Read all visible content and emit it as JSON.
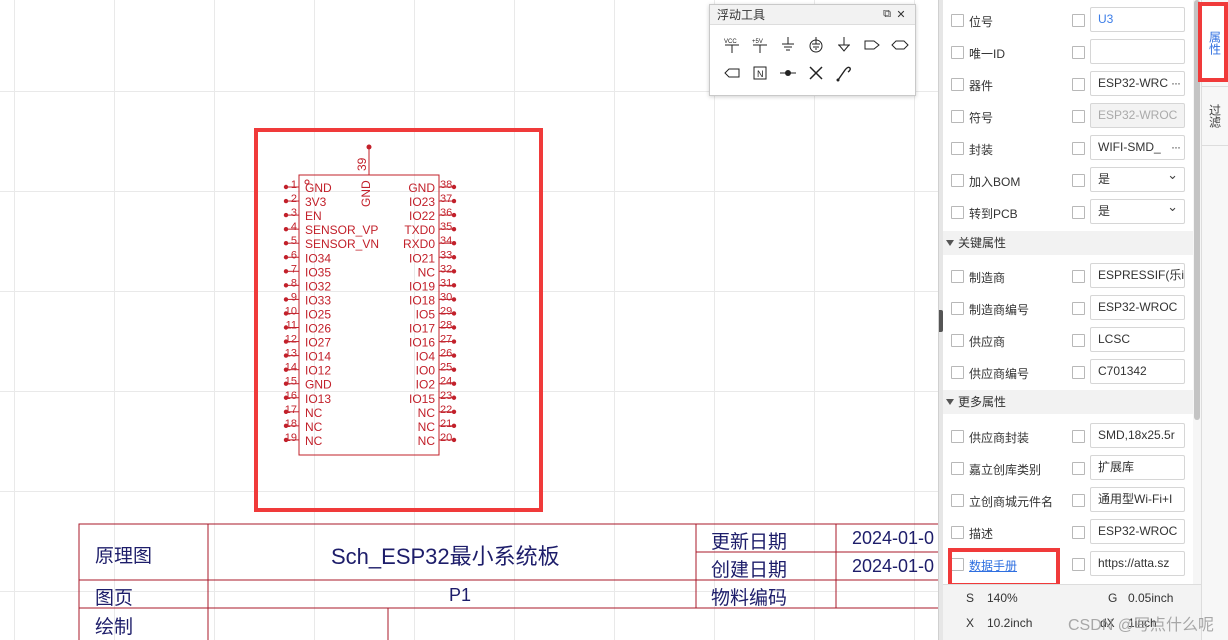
{
  "canvas": {
    "part": {
      "top_pin": {
        "number": "39",
        "name": "GND"
      },
      "left_pins": [
        {
          "num": "1",
          "name": "GND"
        },
        {
          "num": "2",
          "name": "3V3"
        },
        {
          "num": "3",
          "name": "EN"
        },
        {
          "num": "4",
          "name": "SENSOR_VP"
        },
        {
          "num": "5",
          "name": "SENSOR_VN"
        },
        {
          "num": "6",
          "name": "IO34"
        },
        {
          "num": "7",
          "name": "IO35"
        },
        {
          "num": "8",
          "name": "IO32"
        },
        {
          "num": "9",
          "name": "IO33"
        },
        {
          "num": "10",
          "name": "IO25"
        },
        {
          "num": "11",
          "name": "IO26"
        },
        {
          "num": "12",
          "name": "IO27"
        },
        {
          "num": "13",
          "name": "IO14"
        },
        {
          "num": "14",
          "name": "IO12"
        },
        {
          "num": "15",
          "name": "GND"
        },
        {
          "num": "16",
          "name": "IO13"
        },
        {
          "num": "17",
          "name": "NC"
        },
        {
          "num": "18",
          "name": "NC"
        },
        {
          "num": "19",
          "name": "NC"
        }
      ],
      "right_pins": [
        {
          "num": "38",
          "name": "GND"
        },
        {
          "num": "37",
          "name": "IO23"
        },
        {
          "num": "36",
          "name": "IO22"
        },
        {
          "num": "35",
          "name": "TXD0"
        },
        {
          "num": "34",
          "name": "RXD0"
        },
        {
          "num": "33",
          "name": "IO21"
        },
        {
          "num": "32",
          "name": "NC"
        },
        {
          "num": "31",
          "name": "IO19"
        },
        {
          "num": "30",
          "name": "IO18"
        },
        {
          "num": "29",
          "name": "IO5"
        },
        {
          "num": "28",
          "name": "IO17"
        },
        {
          "num": "27",
          "name": "IO16"
        },
        {
          "num": "26",
          "name": "IO4"
        },
        {
          "num": "25",
          "name": "IO0"
        },
        {
          "num": "24",
          "name": "IO2"
        },
        {
          "num": "23",
          "name": "IO15"
        },
        {
          "num": "22",
          "name": "NC"
        },
        {
          "num": "21",
          "name": "NC"
        },
        {
          "num": "20",
          "name": "NC"
        }
      ]
    },
    "title_block": {
      "schematic_label": "原理图",
      "title": "Sch_ESP32最小系统板",
      "updated_label": "更新日期",
      "updated_value": "2024-01-0",
      "created_label": "创建日期",
      "created_value": "2024-01-0",
      "page_label": "图页",
      "page_value": "P1",
      "material_label": "物料编码",
      "drawn_label": "绘制"
    }
  },
  "float_tools": {
    "title": "浮动工具",
    "icons": [
      "vcc-icon",
      "plus5v-icon",
      "ground-icon",
      "earth-ground-icon",
      "analog-ground-icon",
      "net-port-out-icon",
      "net-port-bidir-icon",
      "net-port-in-icon",
      "net-label-icon",
      "junction-icon",
      "no-connect-icon",
      "probe-icon"
    ]
  },
  "properties": {
    "rows_top": [
      {
        "label": "位号",
        "value": "U3",
        "style": "blue"
      },
      {
        "label": "唯一ID",
        "value": "",
        "style": ""
      },
      {
        "label": "器件",
        "value": "ESP32-WRC",
        "style": "more"
      },
      {
        "label": "符号",
        "value": "ESP32-WROC",
        "style": "dis"
      },
      {
        "label": "封装",
        "value": "WIFI-SMD_",
        "style": "more"
      },
      {
        "label": "加入BOM",
        "value": "是",
        "style": "sel"
      },
      {
        "label": "转到PCB",
        "value": "是",
        "style": "sel"
      }
    ],
    "section_key": "关键属性",
    "rows_key": [
      {
        "label": "制造商",
        "value": "ESPRESSIF(乐i"
      },
      {
        "label": "制造商编号",
        "value": "ESP32-WROC"
      },
      {
        "label": "供应商",
        "value": "LCSC"
      },
      {
        "label": "供应商编号",
        "value": "C701342"
      }
    ],
    "section_more": "更多属性",
    "rows_more": [
      {
        "label": "供应商封装",
        "value": "SMD,18x25.5r"
      },
      {
        "label": "嘉立创库类别",
        "value": "扩展库"
      },
      {
        "label": "立创商城元件名",
        "value": "通用型Wi-Fi+I"
      },
      {
        "label": "描述",
        "value": "ESP32-WROC"
      },
      {
        "label": "数据手册",
        "value": "https://atta.sz",
        "link": true
      }
    ]
  },
  "tabs": {
    "attributes": "属性",
    "filter": "过滤"
  },
  "status": {
    "s_label": "S",
    "s_value": "140%",
    "g_label": "G",
    "g_value": "0.05inch",
    "x_label": "X",
    "x_value": "10.2inch",
    "y_label": "dX",
    "y_value": "1inch"
  },
  "watermark": "CSDN @写点什么呢",
  "colors": {
    "schematic_red": "#c2202a",
    "title_text": "#1d1d6a",
    "highlight": "#f03a3a",
    "accent_blue": "#2f6fe0"
  }
}
